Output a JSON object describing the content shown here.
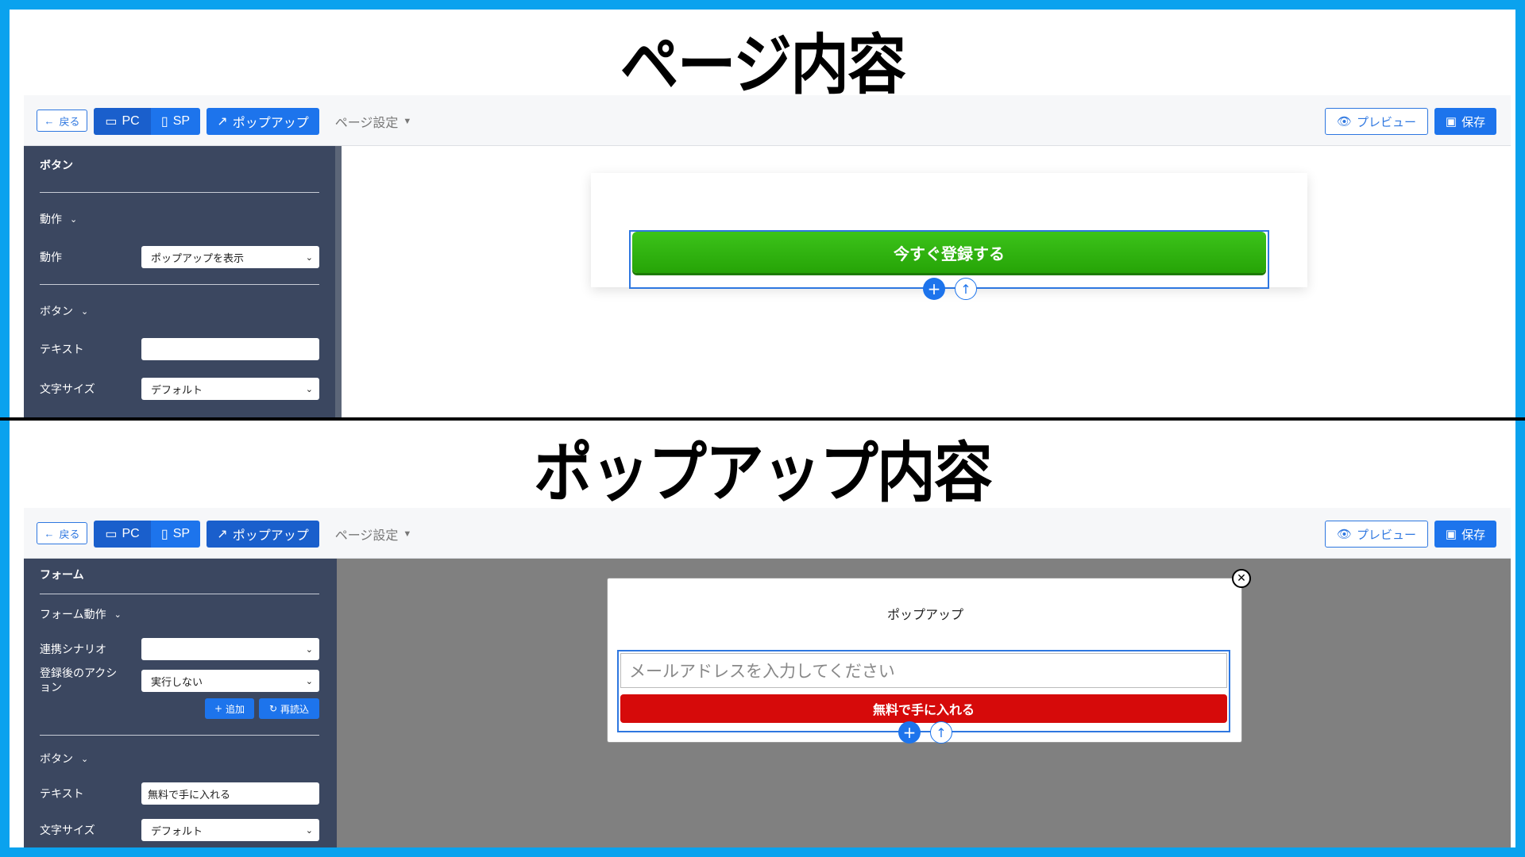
{
  "headings": {
    "top": "ページ内容",
    "bottom": "ポップアップ内容"
  },
  "toolbar": {
    "back_label": "戻る",
    "pc_label": "PC",
    "sp_label": "SP",
    "popup_label": "ポップアップ",
    "page_settings_label": "ページ設定",
    "preview_label": "プレビュー",
    "save_label": "保存"
  },
  "page_editor": {
    "sidebar": {
      "title": "ボタン",
      "section_action": "動作",
      "action_label": "動作",
      "action_value": "ポップアップを表示",
      "section_button": "ボタン",
      "text_label": "テキスト",
      "text_value": "",
      "font_size_label": "文字サイズ",
      "font_size_value": "デフォルト"
    },
    "canvas": {
      "cta_label": "今すぐ登録する",
      "add_symbol": "+",
      "up_symbol": "↑"
    }
  },
  "popup_editor": {
    "sidebar": {
      "title": "フォーム",
      "section_form_action": "フォーム動作",
      "scenario_label": "連携シナリオ",
      "scenario_value": "",
      "after_action_label": "登録後のアクション",
      "after_action_value": "実行しない",
      "add_label": "追加",
      "reload_label": "再読込",
      "section_button": "ボタン",
      "text_label": "テキスト",
      "text_value": "無料で手に入れる",
      "font_size_label": "文字サイズ",
      "font_size_value": "デフォルト"
    },
    "canvas": {
      "popup_title": "ポップアップ",
      "email_placeholder": "メールアドレスを入力してください",
      "submit_label": "無料で手に入れる",
      "add_symbol": "+",
      "up_symbol": "↑",
      "close_symbol": "✕"
    }
  },
  "colors": {
    "frame": "#0aa2ee",
    "primary": "#1d74ec",
    "sidebar": "#3b4760",
    "cta_green": "#2fb310",
    "cta_red": "#d60a0a"
  }
}
